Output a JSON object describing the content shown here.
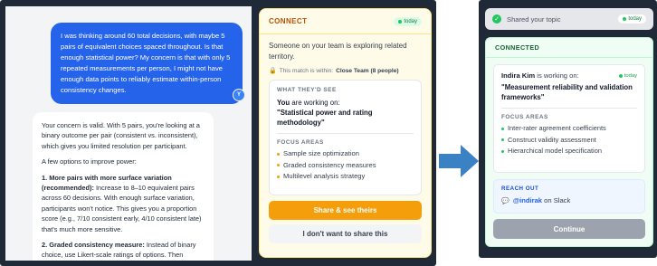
{
  "left_panel": {
    "user_message": "I was thinking around 60 total decisions, with maybe 5 pairs of equivalent choices spaced throughout. Is that enough statistical power? My concern is that with only 5 repeated measurements per person, I might not have enough data points to reliably estimate within-person consistency changes.",
    "user_avatar": "Y",
    "assistant": {
      "p1": "Your concern is valid. With 5 pairs, you're looking at a binary outcome per pair (consistent vs. inconsistent), which gives you limited resolution per participant.",
      "p2": "A few options to improve power:",
      "p3_bold": "1. More pairs with more surface variation (recommended):",
      "p3_rest": " Increase to 8–10 equivalent pairs across 60 decisions. With enough surface variation, participants won't notice. This gives you a proportion score (e.g., 7/10 consistent early, 4/10 consistent late) that's much more sensitive.",
      "p4_bold": "2. Graded consistency measure:",
      "p4_rest": " Instead of binary choice, use Likert-scale ratings of options. Then consistency = correlation between ratings of"
    },
    "connect": {
      "title": "CONNECT",
      "badge": "today",
      "intro": "Someone on your team is exploring related territory.",
      "match_prefix": "This match is within:",
      "match_value": "Close Team (8 people)",
      "what_label": "WHAT THEY'D SEE",
      "you_word": "You",
      "working_rest": " are working on:",
      "topic": "\"Statistical power and rating methodology\"",
      "focus_label": "FOCUS AREAS",
      "focus": [
        "Sample size optimization",
        "Graded consistency measures",
        "Multilevel analysis strategy"
      ],
      "share_button": "Share & see theirs",
      "decline_button": "I don't want to share this"
    }
  },
  "right_panel": {
    "shared_label": "Shared your topic",
    "shared_badge": "today",
    "connected_title": "CONNECTED",
    "person_name": "Indira Kim",
    "person_rest": " is working on:",
    "person_badge": "today",
    "person_topic": "\"Measurement reliability and validation frameworks\"",
    "focus_label": "FOCUS AREAS",
    "focus": [
      "Inter-rater agreement coefficients",
      "Construct validity assessment",
      "Hierarchical model specification"
    ],
    "reach_label": "REACH OUT",
    "slack_handle": "@indirak",
    "slack_rest": " on Slack",
    "continue_button": "Continue"
  },
  "colors": {
    "accent_blue": "#2563eb",
    "accent_orange": "#f59e0b",
    "success_green": "#22c55e",
    "arrow_blue": "#3b82c4"
  }
}
